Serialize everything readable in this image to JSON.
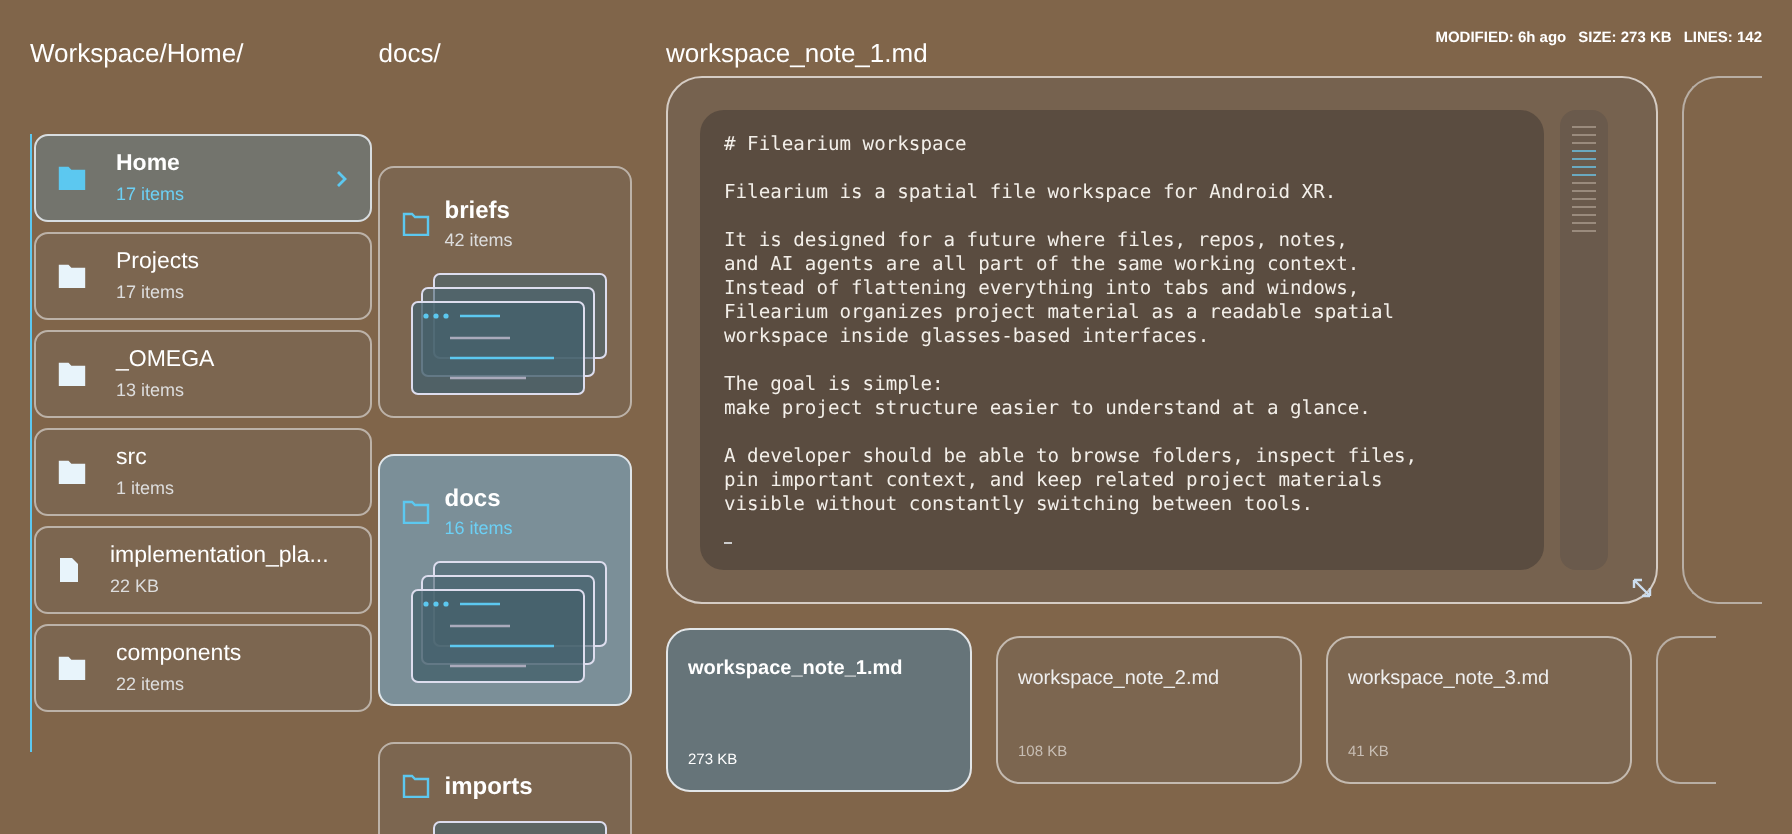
{
  "breadcrumb": "Workspace/Home/",
  "tree": [
    {
      "kind": "folder",
      "name": "Home",
      "count": "17 items",
      "selected": true
    },
    {
      "kind": "folder",
      "name": "Projects",
      "count": "17 items",
      "selected": false
    },
    {
      "kind": "folder",
      "name": "_OMEGA",
      "count": "13 items",
      "selected": false
    },
    {
      "kind": "folder",
      "name": "src",
      "count": "1 items",
      "selected": false
    },
    {
      "kind": "file",
      "name": "implementation_pla...",
      "count": "22 KB",
      "selected": false
    },
    {
      "kind": "folder",
      "name": "components",
      "count": "22 items",
      "selected": false
    }
  ],
  "folder_column": {
    "title": "docs/",
    "folders": [
      {
        "name": "briefs",
        "count": "42 items",
        "selected": false
      },
      {
        "name": "docs",
        "count": "16 items",
        "selected": true
      },
      {
        "name": "imports",
        "selected": false
      }
    ]
  },
  "editor": {
    "filename": "workspace_note_1.md",
    "meta": [
      "MODIFIED: 6h ago",
      "SIZE: 273 KB",
      "LINES: 142"
    ],
    "paragraphs": [
      [
        "# Filearium workspace"
      ],
      [
        "Filearium is a spatial file workspace for Android XR."
      ],
      [
        "It is designed for a future where files, repos, notes,",
        "and AI agents are all part of the same working context.",
        "Instead of flattening everything into tabs and windows,",
        "Filearium organizes project material as a readable spatial",
        "workspace inside glasses-based interfaces."
      ],
      [
        "The goal is simple:",
        "make project structure easier to understand at a glance."
      ],
      [
        "A developer should be able to browse folders, inspect files,",
        "pin important context, and keep related project materials",
        "visible without constantly switching between tools."
      ]
    ]
  },
  "files": [
    {
      "name": "workspace_note_1.md",
      "size": "273 KB",
      "selected": true
    },
    {
      "name": "workspace_note_2.md",
      "size": "108 KB",
      "selected": false
    },
    {
      "name": "workspace_note_3.md",
      "size": "41 KB",
      "selected": false
    }
  ]
}
